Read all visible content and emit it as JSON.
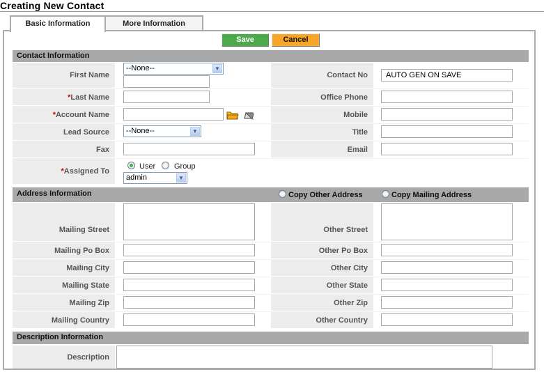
{
  "page": {
    "title": "Creating New Contact"
  },
  "tabs": [
    {
      "label": "Basic Information",
      "active": true
    },
    {
      "label": "More Information",
      "active": false
    }
  ],
  "toolbar": {
    "save_label": "Save",
    "cancel_label": "Cancel"
  },
  "colors": {
    "save": "#4caa4c",
    "cancel": "#f8a628",
    "section_header": "#a9a9a9",
    "label_bg": "#ececec",
    "required_mark": "#cc0000"
  },
  "sections": {
    "contact": {
      "title": "Contact Information",
      "fields": {
        "first_name": {
          "label": "First Name",
          "salutation_value": "--None--",
          "value": ""
        },
        "last_name": {
          "label": "Last Name",
          "required_mark": "*",
          "value": ""
        },
        "account_name": {
          "label": "Account Name",
          "required_mark": "*",
          "value": ""
        },
        "lead_source": {
          "label": "Lead Source",
          "value": "--None--"
        },
        "fax": {
          "label": "Fax",
          "value": ""
        },
        "assigned_to": {
          "label": "Assigned To",
          "required_mark": "*",
          "radio_user": "User",
          "radio_group": "Group",
          "selected": "User",
          "value": "admin"
        },
        "contact_no": {
          "label": "Contact No",
          "value": "AUTO GEN ON SAVE"
        },
        "office_phone": {
          "label": "Office Phone",
          "value": ""
        },
        "mobile": {
          "label": "Mobile",
          "value": ""
        },
        "title": {
          "label": "Title",
          "value": ""
        },
        "email": {
          "label": "Email",
          "value": ""
        }
      }
    },
    "address": {
      "title": "Address Information",
      "copy_other": "Copy Other Address",
      "copy_mailing": "Copy Mailing Address",
      "fields": {
        "mailing_street": {
          "label": "Mailing Street",
          "value": ""
        },
        "mailing_po_box": {
          "label": "Mailing Po Box",
          "value": ""
        },
        "mailing_city": {
          "label": "Mailing City",
          "value": ""
        },
        "mailing_state": {
          "label": "Mailing State",
          "value": ""
        },
        "mailing_zip": {
          "label": "Mailing Zip",
          "value": ""
        },
        "mailing_country": {
          "label": "Mailing Country",
          "value": ""
        },
        "other_street": {
          "label": "Other Street",
          "value": ""
        },
        "other_po_box": {
          "label": "Other Po Box",
          "value": ""
        },
        "other_city": {
          "label": "Other City",
          "value": ""
        },
        "other_state": {
          "label": "Other State",
          "value": ""
        },
        "other_zip": {
          "label": "Other Zip",
          "value": ""
        },
        "other_country": {
          "label": "Other Country",
          "value": ""
        }
      }
    },
    "description": {
      "title": "Description Information",
      "fields": {
        "description": {
          "label": "Description",
          "value": ""
        }
      }
    }
  }
}
